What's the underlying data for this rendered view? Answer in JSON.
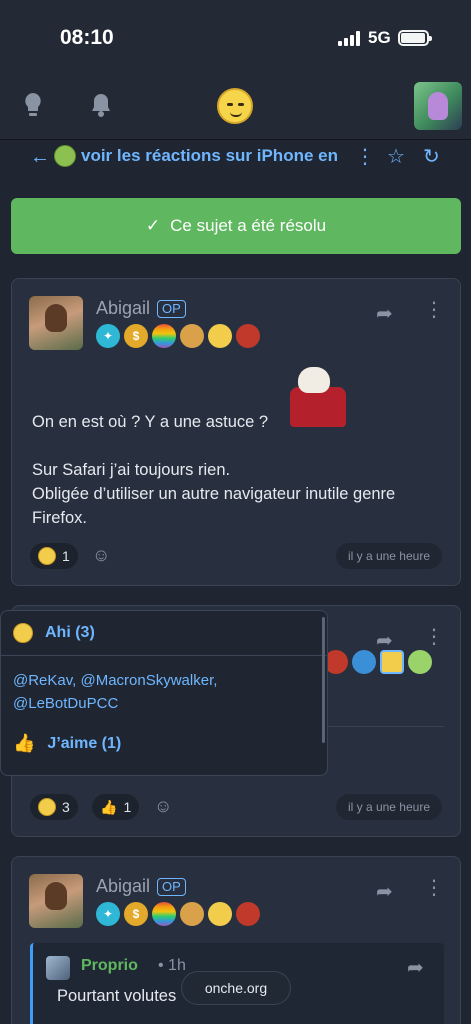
{
  "status_bar": {
    "time": "08:10",
    "network": "5G"
  },
  "nav": {
    "icons": [
      "bulb-icon",
      "bell-icon"
    ]
  },
  "topic": {
    "title": "voir les réactions sur iPhone en"
  },
  "resolved_banner": {
    "check": "✓",
    "label": "Ce sujet a été résolu"
  },
  "post1": {
    "author": "Abigail",
    "op_label": "OP",
    "lines": [
      "On en est où ? Y a une astuce ?",
      "",
      "Sur Safari j’ai toujours rien.",
      "Obligée d’utiliser un autre navigateur inutile genre",
      "Firefox."
    ],
    "reaction_count": "1",
    "time": "il y a une heure"
  },
  "popover": {
    "title1": "Ahi (3)",
    "names": "@ReKav, @MacronSkywalker, @LeBotDuPCC",
    "title2": "J’aime (1)"
  },
  "post2": {
    "reaction1_count": "3",
    "reaction2_count": "1",
    "time": "il y a une heure"
  },
  "post3": {
    "author": "Abigail",
    "op_label": "OP",
    "quote_author": "Proprio",
    "quote_time": "• 1h",
    "quote_text": "Pourtant volutes"
  },
  "domain": "onche.org",
  "colors": {
    "accent": "#6fb6ff",
    "success": "#5fb760",
    "background": "#1f2631",
    "card": "#283040"
  }
}
